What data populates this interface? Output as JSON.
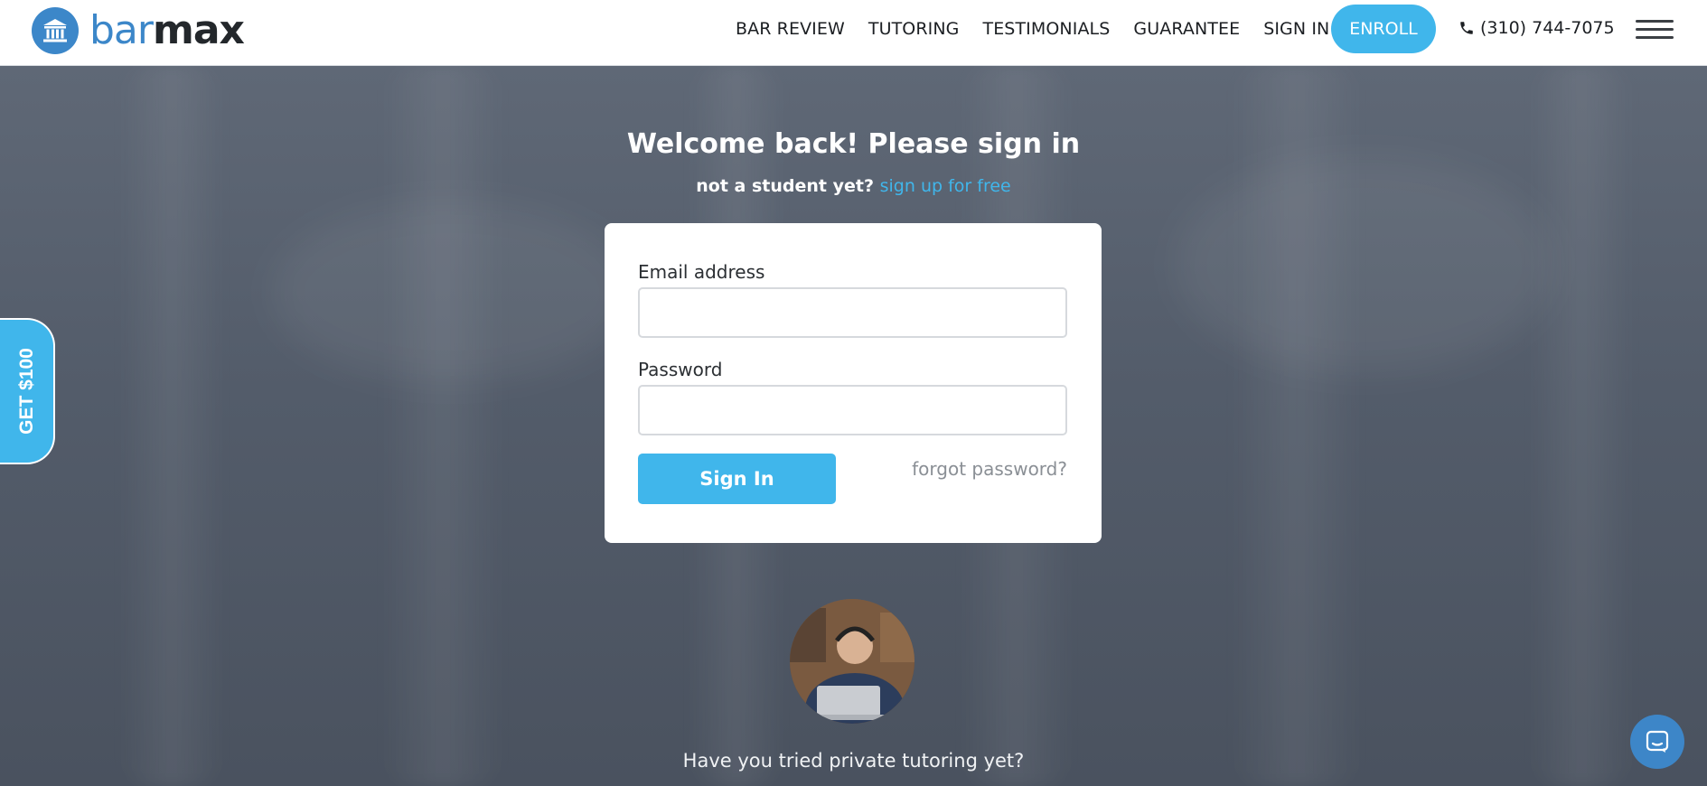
{
  "brand": {
    "name_part1": "bar",
    "name_part2": "max",
    "logo_icon": "courthouse-icon",
    "accent_color": "#3c87c9"
  },
  "nav": {
    "items": [
      {
        "label": "BAR REVIEW"
      },
      {
        "label": "TUTORING"
      },
      {
        "label": "TESTIMONIALS"
      },
      {
        "label": "GUARANTEE"
      },
      {
        "label": "SIGN IN"
      }
    ],
    "enroll_label": "ENROLL",
    "phone": "(310) 744-7075",
    "phone_icon": "phone-icon",
    "menu_icon": "hamburger-menu-icon",
    "cta_color": "#40b6eb"
  },
  "login": {
    "heading": "Welcome back! Please sign in",
    "not_student": "not a student yet?",
    "signup_link": "sign up for free",
    "email_label": "Email address",
    "email_value": "",
    "password_label": "Password",
    "password_value": "",
    "signin_label": "Sign In",
    "forgot_label": "forgot password?"
  },
  "promo": {
    "tab_label": "GET $100",
    "tutoring_question": "Have you tried private tutoring yet?"
  },
  "chat": {
    "icon": "chat-bubble-icon"
  }
}
